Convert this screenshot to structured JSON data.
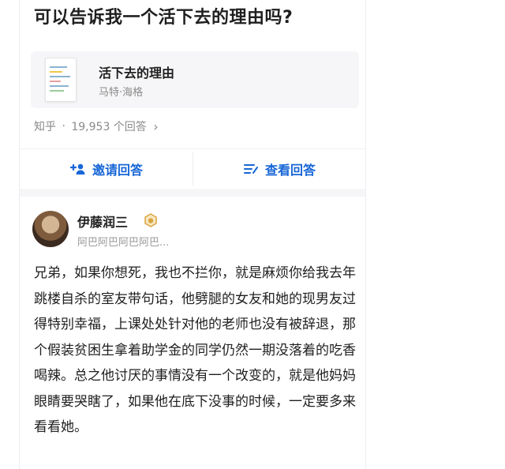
{
  "question": {
    "title": "可以告诉我一个活下去的理由吗?"
  },
  "book": {
    "title": "活下去的理由",
    "author": "马特·海格"
  },
  "meta": {
    "source": "知乎",
    "separator": "·",
    "answers_count": "19,953 个回答",
    "chevron": "›"
  },
  "actions": {
    "invite_label": "邀请回答",
    "view_label": "查看回答"
  },
  "answer": {
    "author_name": "伊藤润三",
    "author_subtitle": "阿巴阿巴阿巴阿巴...",
    "text": "兄弟，如果你想死，我也不拦你，就是麻烦你给我去年跳楼自杀的室友带句话，他劈腿的女友和她的现男友过得特别幸福，上课处处针对他的老师也没有被辞退，那个假装贫困生拿着助学金的同学仍然一期没落着的吃香喝辣。总之他讨厌的事情没有一个改变的，就是他妈妈眼睛要哭瞎了，如果他在底下没事的时候，一定要多来看看她。"
  },
  "icons": {
    "invite": "add-person-icon",
    "view": "list-icon",
    "badge": "hexagon-badge-icon",
    "chevron": "chevron-right-icon"
  },
  "colors": {
    "accent": "#1766d6",
    "text": "#1f1f1f",
    "muted": "#8a8a8a",
    "badge": "#d9a441"
  }
}
